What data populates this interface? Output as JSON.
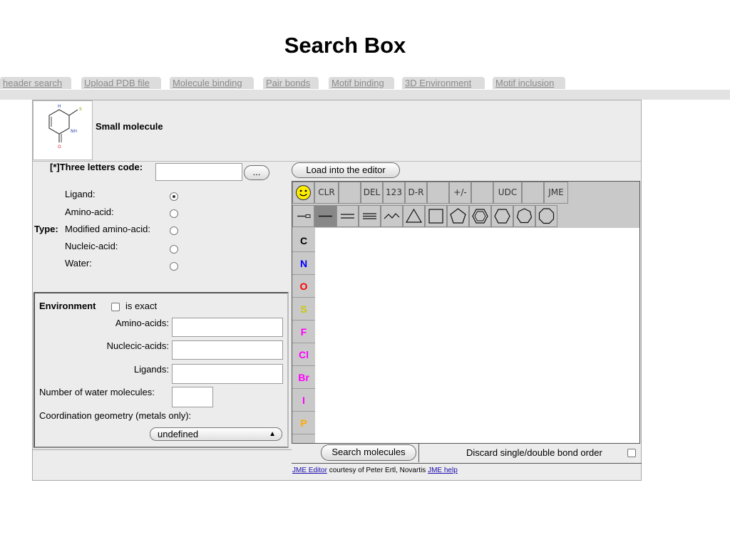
{
  "page": {
    "title": "Search Box"
  },
  "tabs": [
    "header search",
    "Upload PDB file",
    "Molecule binding",
    "Pair bonds",
    "Motif binding",
    "3D Environment",
    "Motif inclusion"
  ],
  "molecule": {
    "label": "Small molecule",
    "thumbnail_icon": "molecule-structure-icon"
  },
  "three_letters": {
    "label": "[*]Three letters code:",
    "value": "",
    "browse_label": "..."
  },
  "type": {
    "label": "Type:",
    "options": [
      {
        "label": "Ligand:",
        "checked": true
      },
      {
        "label": "Amino-acid:",
        "checked": false
      },
      {
        "label": "Modified amino-acid:",
        "checked": false
      },
      {
        "label": "Nucleic-acid:",
        "checked": false
      },
      {
        "label": "Water:",
        "checked": false
      }
    ]
  },
  "environment": {
    "title": "Environment",
    "exact_label": "is exact",
    "exact_checked": false,
    "amino_acids_label": "Amino-acids:",
    "nucleic_acids_label": "Nuclecic-acids:",
    "ligands_label": "Ligands:",
    "water_label": "Number of water molecules:",
    "coordination_label": "Coordination geometry (metals only):",
    "geometry_value": "undefined"
  },
  "editor": {
    "load_label": "Load into the editor",
    "toolbar_row1": [
      "smiley-icon",
      "CLR",
      "",
      "DEL",
      "123",
      "D-R",
      "",
      "+/-",
      "",
      "UDC",
      "",
      "JME"
    ],
    "toolbar_row2": [
      "chain-icon",
      "single-bond-icon",
      "double-bond-icon",
      "triple-bond-icon",
      "chain-wave-icon",
      "triangle-ring-icon",
      "square-ring-icon",
      "pentagon-ring-icon",
      "benzene-ring-icon",
      "hexagon-ring-icon",
      "heptagon-ring-icon",
      "octagon-ring-icon"
    ],
    "atoms": [
      {
        "symbol": "C",
        "color": "#333333"
      },
      {
        "symbol": "N",
        "color": "#0000ff"
      },
      {
        "symbol": "O",
        "color": "#ff0000"
      },
      {
        "symbol": "S",
        "color": "#c8c800"
      },
      {
        "symbol": "F",
        "color": "#ff00ff"
      },
      {
        "symbol": "Cl",
        "color": "#ff00ff"
      },
      {
        "symbol": "Br",
        "color": "#ff00ff"
      },
      {
        "symbol": "I",
        "color": "#ff00ff"
      },
      {
        "symbol": "P",
        "color": "#ffaa00"
      }
    ]
  },
  "search": {
    "button_label": "Search molecules",
    "discard_label": "Discard single/double bond order"
  },
  "credits": {
    "editor_link": "JME Editor",
    "courtesy_text": "courtesy of Peter Ertl, Novartis",
    "help_link": "JME help"
  }
}
